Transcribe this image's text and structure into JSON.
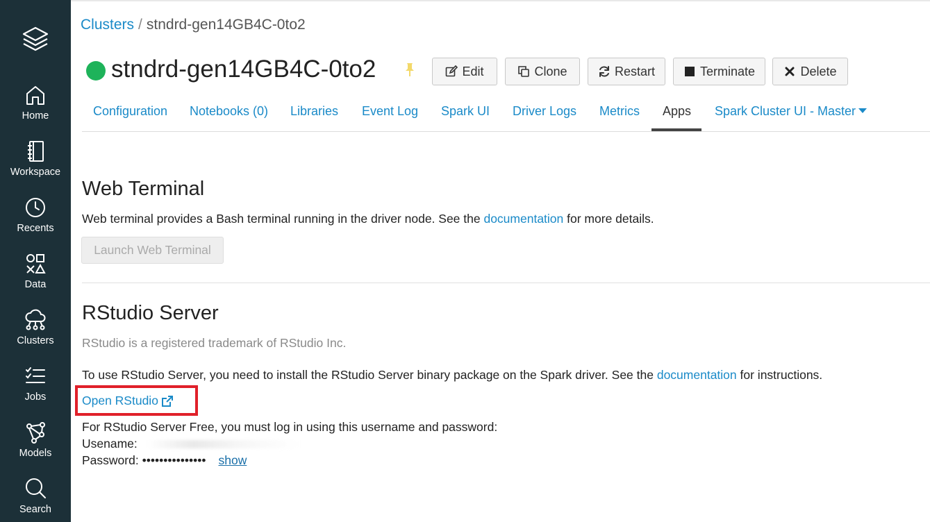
{
  "sidebar": {
    "logo_icon": "layers-stack-icon",
    "items": [
      {
        "label": "Home",
        "icon": "home-icon"
      },
      {
        "label": "Workspace",
        "icon": "notebook-icon"
      },
      {
        "label": "Recents",
        "icon": "clock-icon"
      },
      {
        "label": "Data",
        "icon": "shapes-icon"
      },
      {
        "label": "Clusters",
        "icon": "cloud-network-icon"
      },
      {
        "label": "Jobs",
        "icon": "checklist-icon"
      },
      {
        "label": "Models",
        "icon": "model-graph-icon"
      },
      {
        "label": "Search",
        "icon": "search-icon"
      }
    ]
  },
  "breadcrumb": {
    "root": "Clusters",
    "separator": "/",
    "current": "stndrd-gen14GB4C-0to2"
  },
  "cluster": {
    "name": "stndrd-gen14GB4C-0to2",
    "status_color": "#1eb35a"
  },
  "actions": {
    "edit": "Edit",
    "clone": "Clone",
    "restart": "Restart",
    "terminate": "Terminate",
    "delete": "Delete"
  },
  "tabs": [
    {
      "label": "Configuration"
    },
    {
      "label": "Notebooks (0)"
    },
    {
      "label": "Libraries"
    },
    {
      "label": "Event Log"
    },
    {
      "label": "Spark UI"
    },
    {
      "label": "Driver Logs"
    },
    {
      "label": "Metrics"
    },
    {
      "label": "Apps",
      "active": true
    },
    {
      "label": "Spark Cluster UI - Master"
    }
  ],
  "web_terminal": {
    "title": "Web Terminal",
    "desc_before": "Web terminal provides a Bash terminal running in the driver node. See the ",
    "desc_link": "documentation",
    "desc_after": " for more details.",
    "launch_button": "Launch Web Terminal"
  },
  "rstudio": {
    "title": "RStudio Server",
    "trademark": "RStudio is a registered trademark of RStudio Inc.",
    "install_before": "To use RStudio Server, you need to install the RStudio Server binary package on the Spark driver. See the ",
    "install_link": "documentation",
    "install_after": " for instructions.",
    "open_link": "Open RStudio",
    "free_note": "For RStudio Server Free, you must log in using this username and password:",
    "username_label": "Usename:",
    "password_label": "Password:",
    "password_mask": "•••••••••••••••",
    "show_link": "show"
  },
  "colors": {
    "sidebar_bg": "#1c3038",
    "link": "#1a8ac8",
    "highlight": "#e0202a"
  }
}
